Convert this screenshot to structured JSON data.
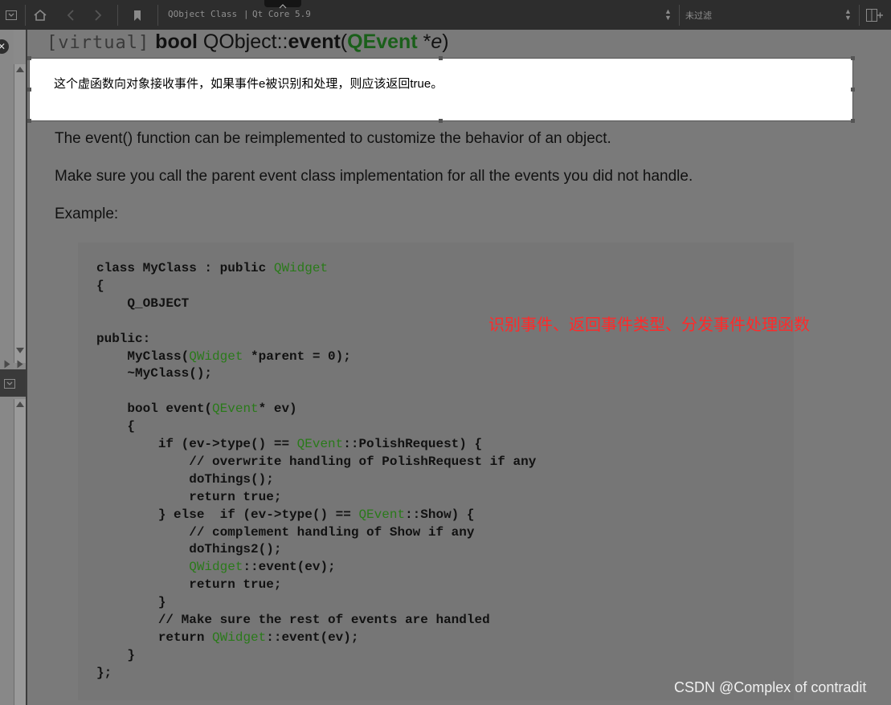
{
  "toolbar": {
    "breadcrumb_class": "QObject Class",
    "breadcrumb_sep": "|",
    "breadcrumb_module": "Qt Core 5.9",
    "filter_value": "未过滤"
  },
  "icons": {
    "panel_toggle": "panel-dropdown-icon",
    "home": "home-icon",
    "back": "chevron-left-icon",
    "forward": "chevron-right-icon",
    "bookmark": "bookmark-icon",
    "split": "split-view-icon",
    "close": "close-icon"
  },
  "doc": {
    "heading": {
      "virtual": "[virtual]",
      "return_type": "bool",
      "scope": "QObject::",
      "method": "event",
      "open_paren": "(",
      "param_type": "QEvent",
      "star": " *",
      "param_name": "e",
      "close_paren": ")"
    },
    "translation": "这个虚函数向对象接收事件，如果事件e被识别和处理，则应该返回true。",
    "paragraphs": [
      "The event() function can be reimplemented to customize the behavior of an object.",
      "Make sure you call the parent event class implementation for all the events you did not handle.",
      "Example:"
    ],
    "code": [
      [
        {
          "t": "class MyClass : public "
        },
        {
          "t": "QWidget",
          "g": true
        }
      ],
      [
        {
          "t": "{"
        }
      ],
      [
        {
          "t": "    Q_OBJECT"
        }
      ],
      [
        {
          "t": ""
        }
      ],
      [
        {
          "t": "public:"
        }
      ],
      [
        {
          "t": "    MyClass("
        },
        {
          "t": "QWidget",
          "g": true
        },
        {
          "t": " *parent = 0);"
        }
      ],
      [
        {
          "t": "    ~MyClass();"
        }
      ],
      [
        {
          "t": ""
        }
      ],
      [
        {
          "t": "    bool event("
        },
        {
          "t": "QEvent",
          "g": true
        },
        {
          "t": "* ev)"
        }
      ],
      [
        {
          "t": "    {"
        }
      ],
      [
        {
          "t": "        if (ev->type() == "
        },
        {
          "t": "QEvent",
          "g": true
        },
        {
          "t": "::PolishRequest) {"
        }
      ],
      [
        {
          "t": "            // overwrite handling of PolishRequest if any"
        }
      ],
      [
        {
          "t": "            doThings();"
        }
      ],
      [
        {
          "t": "            return true;"
        }
      ],
      [
        {
          "t": "        } else  if (ev->type() == "
        },
        {
          "t": "QEvent",
          "g": true
        },
        {
          "t": "::Show) {"
        }
      ],
      [
        {
          "t": "            // complement handling of Show if any"
        }
      ],
      [
        {
          "t": "            doThings2();"
        }
      ],
      [
        {
          "t": "            "
        },
        {
          "t": "QWidget",
          "g": true
        },
        {
          "t": "::event(ev);"
        }
      ],
      [
        {
          "t": "            return true;"
        }
      ],
      [
        {
          "t": "        }"
        }
      ],
      [
        {
          "t": "        // Make sure the rest of events are handled"
        }
      ],
      [
        {
          "t": "        return "
        },
        {
          "t": "QWidget",
          "g": true
        },
        {
          "t": "::event(ev);"
        }
      ],
      [
        {
          "t": "    }"
        }
      ],
      [
        {
          "t": "};"
        }
      ]
    ]
  },
  "annotation": "识别事件、返回事件类型、分发事件处理函数",
  "watermark": "CSDN @Complex of contradit",
  "colors": {
    "keyword_green": "#2a7a1a",
    "annotation_red": "#ff2a2a",
    "toolbar_bg": "#2d2d2d",
    "page_bg": "#7a7a7a"
  }
}
